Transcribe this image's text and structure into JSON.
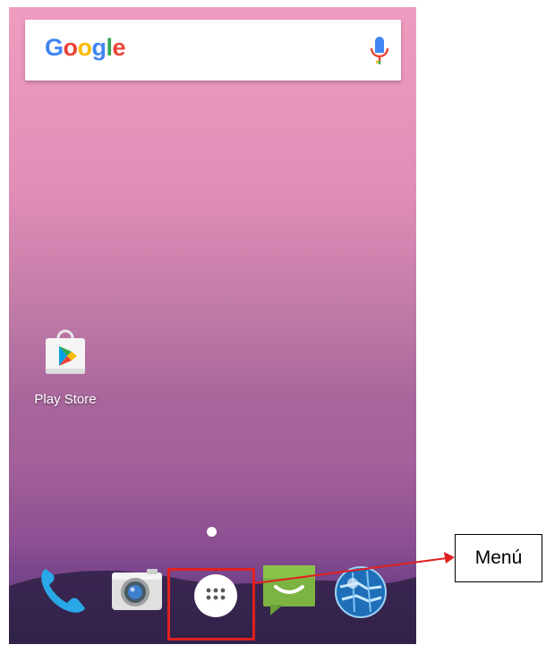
{
  "search": {
    "logo_letters": [
      {
        "char": "G",
        "color": "#4285F4"
      },
      {
        "char": "o",
        "color": "#EA4335"
      },
      {
        "char": "o",
        "color": "#FBBC05"
      },
      {
        "char": "g",
        "color": "#4285F4"
      },
      {
        "char": "l",
        "color": "#34A853"
      },
      {
        "char": "e",
        "color": "#EA4335"
      }
    ],
    "mic_icon": "microphone-icon"
  },
  "home": {
    "apps": [
      {
        "label": "Play Store",
        "icon": "play-store-icon"
      }
    ]
  },
  "dock": {
    "icons": [
      "phone-icon",
      "camera-icon",
      "app-drawer-icon",
      "messaging-icon",
      "browser-icon"
    ]
  },
  "annotation": {
    "label": "Menú",
    "highlight_color": "#e02020",
    "arrow_color": "#e02020"
  }
}
